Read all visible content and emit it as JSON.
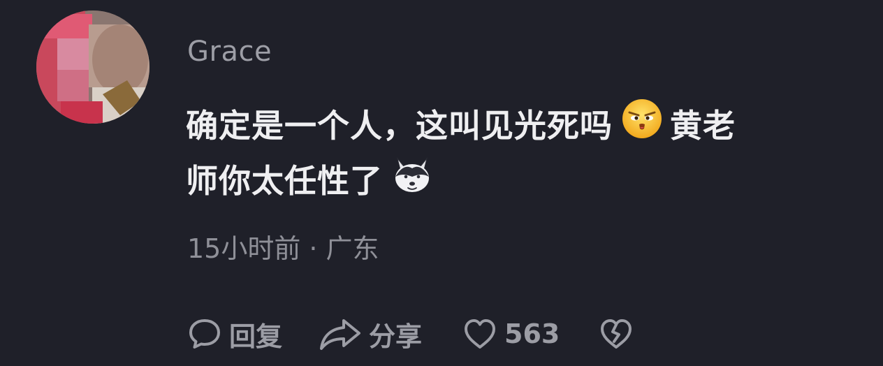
{
  "comment": {
    "username": "Grace",
    "text_line1": "确定是一个人，这叫见光死吗",
    "text_line1b": "黄老",
    "text_line2": "师你太任性了",
    "emoji_1": "smirk-face-emoji",
    "emoji_2": "husky-dog-emoji",
    "time": "15小时前",
    "separator": "·",
    "location": "广东"
  },
  "actions": {
    "reply_label": "回复",
    "share_label": "分享",
    "like_count": "563",
    "reply_icon": "chat-bubble-icon",
    "share_icon": "share-arrow-icon",
    "like_icon": "heart-icon",
    "dislike_icon": "broken-heart-icon"
  },
  "colors": {
    "background": "#1f2029",
    "text_primary": "#efeff1",
    "text_secondary": "#9d9ea6"
  }
}
